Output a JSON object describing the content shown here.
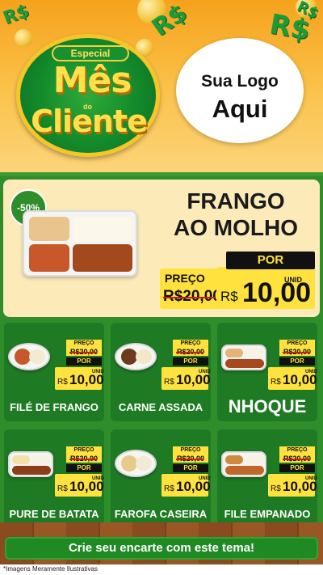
{
  "header": {
    "badge": {
      "especial": "Especial",
      "mes": "Mês",
      "do": "do",
      "cliente": "Cliente"
    },
    "logo": {
      "line1": "Sua Logo",
      "line2": "Aqui"
    },
    "decor": {
      "money_symbol": "R$"
    }
  },
  "featured": {
    "discount": "-50%",
    "title_line1": "FRANGO",
    "title_line2": "AO MOLHO",
    "por_label": "POR",
    "preco_label": "PREÇO",
    "old_price": "R$20,00",
    "currency": "R$",
    "new_price": "10,00",
    "unit": "UNID"
  },
  "products": [
    {
      "name": "FILÉ DE FRANGO",
      "preco_label": "PREÇO",
      "old_price": "R$20,00",
      "por_label": "POR",
      "currency": "R$",
      "new_price": "10,00",
      "unit": "UNID"
    },
    {
      "name": "CARNE ASSADA",
      "preco_label": "PREÇO",
      "old_price": "R$20,00",
      "por_label": "POR",
      "currency": "R$",
      "new_price": "10,00",
      "unit": "UNID"
    },
    {
      "name": "NHOQUE",
      "preco_label": "PREÇO",
      "old_price": "R$20,00",
      "por_label": "POR",
      "currency": "R$",
      "new_price": "10,00",
      "unit": "UNID"
    },
    {
      "name": "PURE DE BATATA",
      "preco_label": "PREÇO",
      "old_price": "R$20,00",
      "por_label": "POR",
      "currency": "R$",
      "new_price": "10,00",
      "unit": "UNID"
    },
    {
      "name": "FAROFA CASEIRA",
      "preco_label": "PREÇO",
      "old_price": "R$20,00",
      "por_label": "POR",
      "currency": "R$",
      "new_price": "10,00",
      "unit": "UNID"
    },
    {
      "name": "FILE EMPANADO",
      "preco_label": "PREÇO",
      "old_price": "R$20,00",
      "por_label": "POR",
      "currency": "R$",
      "new_price": "10,00",
      "unit": "UNID"
    }
  ],
  "cta": {
    "label": "Crie seu encarte com este tema!"
  },
  "footnote": "*Imagens Meramente Ilustrativas",
  "colors": {
    "brand_green": "#2f8d2a",
    "price_yellow": "#ffe23d",
    "header_orange": "#f6a21b"
  }
}
